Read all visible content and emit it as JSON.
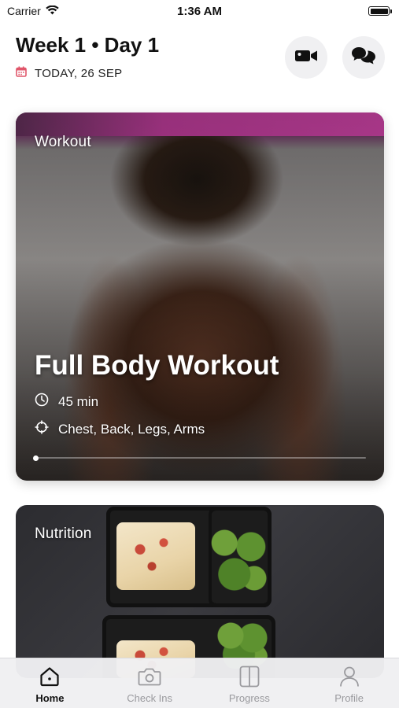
{
  "status_bar": {
    "carrier": "Carrier",
    "time": "1:36 AM"
  },
  "header": {
    "title": "Week 1 • Day 1",
    "date": "TODAY, 26 SEP"
  },
  "actions": {
    "video_icon": "video-camera-icon",
    "chat_icon": "chat-bubbles-icon"
  },
  "workout_card": {
    "label": "Workout",
    "title": "Full Body Workout",
    "duration": "45 min",
    "focus": "Chest, Back, Legs, Arms",
    "progress": 0
  },
  "nutrition_card": {
    "label": "Nutrition"
  },
  "tabs": [
    {
      "label": "Home",
      "icon": "home-icon",
      "active": true
    },
    {
      "label": "Check Ins",
      "icon": "camera-icon",
      "active": false
    },
    {
      "label": "Progress",
      "icon": "compare-icon",
      "active": false
    },
    {
      "label": "Profile",
      "icon": "person-icon",
      "active": false
    }
  ],
  "colors": {
    "accent_date_icon": "#e0566a",
    "tab_active": "#111111",
    "tab_inactive": "#9a9a9e"
  }
}
